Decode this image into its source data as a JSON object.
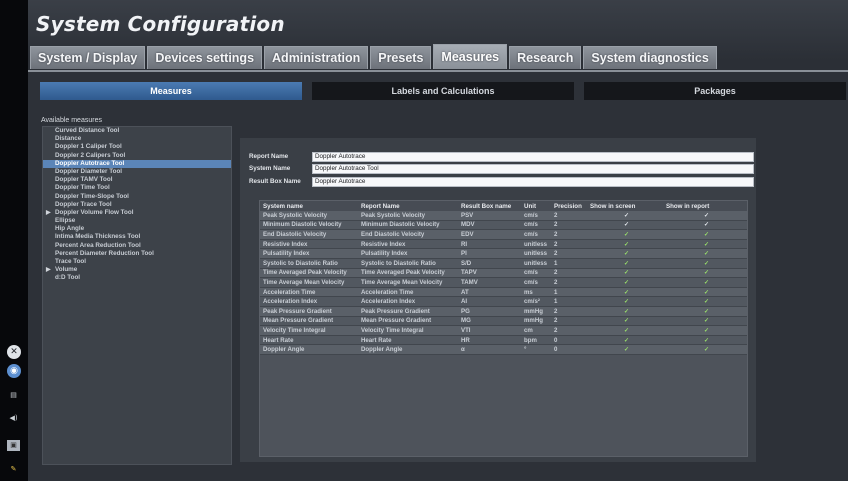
{
  "app": {
    "title": "System Configuration"
  },
  "tabs": [
    "System / Display",
    "Devices settings",
    "Administration",
    "Presets",
    "Measures",
    "Research",
    "System diagnostics"
  ],
  "active_tab": "Measures",
  "subtabs": [
    "Measures",
    "Labels and Calculations",
    "Packages"
  ],
  "active_subtab": "Measures",
  "available_label": "Available measures",
  "measures": [
    {
      "label": "Curved Distance Tool",
      "expandable": false
    },
    {
      "label": "Distance",
      "expandable": false
    },
    {
      "label": "Doppler 1 Caliper Tool",
      "expandable": false
    },
    {
      "label": "Doppler 2 Calipers Tool",
      "expandable": false
    },
    {
      "label": "Doppler Autotrace Tool",
      "expandable": false,
      "selected": true
    },
    {
      "label": "Doppler Diameter Tool",
      "expandable": false
    },
    {
      "label": "Doppler TAMV Tool",
      "expandable": false
    },
    {
      "label": "Doppler Time Tool",
      "expandable": false
    },
    {
      "label": "Doppler Time-Slope Tool",
      "expandable": false
    },
    {
      "label": "Doppler Trace Tool",
      "expandable": false
    },
    {
      "label": "Doppler Volume Flow Tool",
      "expandable": true
    },
    {
      "label": "Ellipse",
      "expandable": false
    },
    {
      "label": "Hip Angle",
      "expandable": false
    },
    {
      "label": "Intima Media Thickness Tool",
      "expandable": false
    },
    {
      "label": "Percent Area Reduction Tool",
      "expandable": false
    },
    {
      "label": "Percent Diameter Reduction Tool",
      "expandable": false
    },
    {
      "label": "Trace Tool",
      "expandable": false
    },
    {
      "label": "Volume",
      "expandable": true
    },
    {
      "label": "d:D Tool",
      "expandable": false
    }
  ],
  "fields": {
    "report_name": {
      "label": "Report Name",
      "value": "Doppler Autotrace"
    },
    "system_name": {
      "label": "System Name",
      "value": "Doppler Autotrace Tool"
    },
    "result_box_name": {
      "label": "Result Box Name",
      "value": "Doppler Autotrace"
    }
  },
  "table": {
    "headers": [
      "System name",
      "Report Name",
      "Result Box name",
      "Unit",
      "Precision",
      "Show in screen",
      "Show in report"
    ],
    "rows": [
      [
        "Peak Systolic Velocity",
        "Peak Systolic Velocity",
        "PSV",
        "cm/s",
        "2",
        "✓",
        "✓"
      ],
      [
        "Minimum Diastolic Velocity",
        "Minimum Diastolic Velocity",
        "MDV",
        "cm/s",
        "2",
        "✓",
        "✓"
      ],
      [
        "End Diastolic Velocity",
        "End Diastolic Velocity",
        "EDV",
        "cm/s",
        "2",
        "✓",
        "✓"
      ],
      [
        "Resistive Index",
        "Resistive Index",
        "RI",
        "unitless",
        "2",
        "✓",
        "✓"
      ],
      [
        "Pulsatility Index",
        "Pulsatility Index",
        "PI",
        "unitless",
        "2",
        "✓",
        "✓"
      ],
      [
        "Systolic to Diastolic Ratio",
        "Systolic to Diastolic Ratio",
        "S/D",
        "unitless",
        "1",
        "✓",
        "✓"
      ],
      [
        "Time Averaged Peak Velocity",
        "Time Averaged Peak Velocity",
        "TAPV",
        "cm/s",
        "2",
        "✓",
        "✓"
      ],
      [
        "Time Average Mean Velocity",
        "Time Average Mean Velocity",
        "TAMV",
        "cm/s",
        "2",
        "✓",
        "✓"
      ],
      [
        "Acceleration Time",
        "Acceleration Time",
        "AT",
        "ms",
        "1",
        "✓",
        "✓"
      ],
      [
        "Acceleration Index",
        "Acceleration Index",
        "AI",
        "cm/s²",
        "1",
        "✓",
        "✓"
      ],
      [
        "Peak Pressure Gradient",
        "Peak Pressure Gradient",
        "PG",
        "mmHg",
        "2",
        "✓",
        "✓"
      ],
      [
        "Mean Pressure Gradient",
        "Mean Pressure Gradient",
        "MG",
        "mmHg",
        "2",
        "✓",
        "✓"
      ],
      [
        "Velocity Time Integral",
        "Velocity Time Integral",
        "VTI",
        "cm",
        "2",
        "✓",
        "✓"
      ],
      [
        "Heart Rate",
        "Heart Rate",
        "HR",
        "bpm",
        "0",
        "✓",
        "✓"
      ],
      [
        "Doppler Angle",
        "Doppler Angle",
        "α",
        "°",
        "0",
        "✓",
        "✓"
      ]
    ]
  },
  "colors": {
    "accent": "#4b7bb2",
    "selected": "#5b85b8",
    "check": "#9be36a"
  },
  "icons": [
    "settings-cross-icon",
    "globe-icon",
    "printer-icon",
    "speaker-icon",
    "image-icon",
    "pen-icon"
  ]
}
